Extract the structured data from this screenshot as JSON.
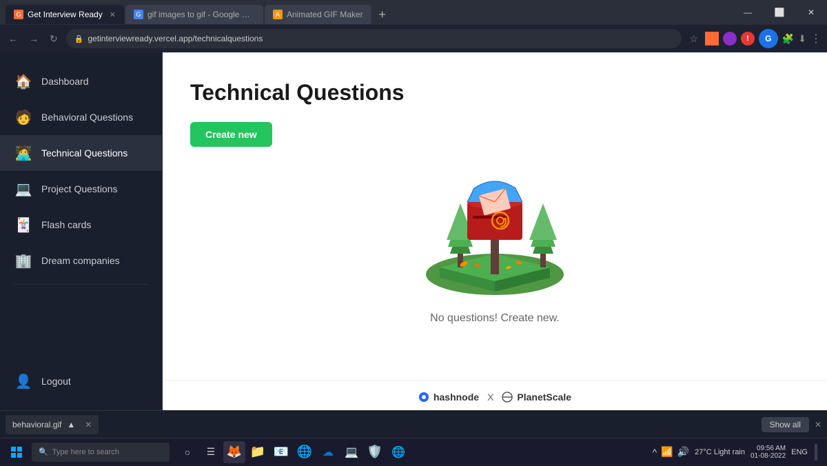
{
  "browser": {
    "tabs": [
      {
        "id": "tab1",
        "label": "Get Interview Ready",
        "favicon_color": "#ff6b35",
        "active": true
      },
      {
        "id": "tab2",
        "label": "gif images to gif - Google Search",
        "favicon_color": "#4285f4",
        "active": false
      },
      {
        "id": "tab3",
        "label": "Animated GIF Maker",
        "favicon_color": "#ff9800",
        "active": false
      }
    ],
    "url": "getinterviewready.vercel.app/technicalquestions",
    "new_tab_label": "+"
  },
  "sidebar": {
    "items": [
      {
        "id": "dashboard",
        "label": "Dashboard",
        "icon": "🏠"
      },
      {
        "id": "behavioral",
        "label": "Behavioral Questions",
        "icon": "🧑"
      },
      {
        "id": "technical",
        "label": "Technical Questions",
        "icon": "🧑‍💻",
        "active": true
      },
      {
        "id": "project",
        "label": "Project Questions",
        "icon": "💻"
      },
      {
        "id": "flashcards",
        "label": "Flash cards",
        "icon": "🃏"
      },
      {
        "id": "dream",
        "label": "Dream companies",
        "icon": "🏢"
      }
    ],
    "logout_label": "Logout",
    "logout_icon": "👤"
  },
  "main": {
    "page_title": "Technical Questions",
    "create_btn_label": "Create new",
    "empty_state_text": "No questions! Create new.",
    "footer": {
      "hashnode_label": "hashnode",
      "x_label": "X",
      "planetscale_label": "PlanetScale"
    }
  },
  "download_bar": {
    "filename": "behavioral.gif",
    "show_all_label": "Show all",
    "chevron_up": "▲"
  },
  "win_taskbar": {
    "search_placeholder": "Type here to search",
    "weather": "27°C  Light rain",
    "time": "09:56 AM",
    "date": "01-08-2022",
    "lang": "ENG",
    "apps": [
      "⊞",
      "🔍",
      "○",
      "☰",
      "🦊",
      "📁",
      "📧",
      "🌐",
      "🔵",
      "💻",
      "🔴",
      "🛡️",
      "🌐"
    ]
  }
}
